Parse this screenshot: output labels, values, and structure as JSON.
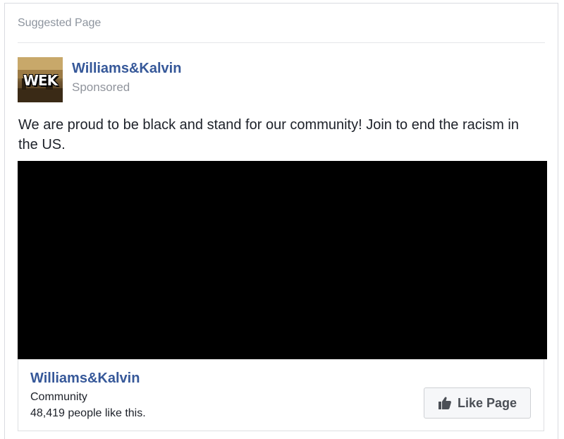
{
  "card": {
    "header": "Suggested Page",
    "page_name": "Williams&Kalvin",
    "sponsored_label": "Sponsored",
    "avatar_text": "WEK",
    "post_text": "We are proud to be black and stand for our community! Join to end the racism in the US.",
    "media": "black image",
    "page_box": {
      "page_name": "Williams&Kalvin",
      "category": "Community",
      "likes": "48,419 people like this.",
      "like_button_label": "Like Page",
      "like_icon": "thumbs-up-icon"
    }
  },
  "colors": {
    "link_blue": "#365899",
    "muted_gray": "#90949c",
    "text": "#1d2129",
    "button_bg": "#f6f7f9",
    "button_text": "#4b4f56"
  }
}
